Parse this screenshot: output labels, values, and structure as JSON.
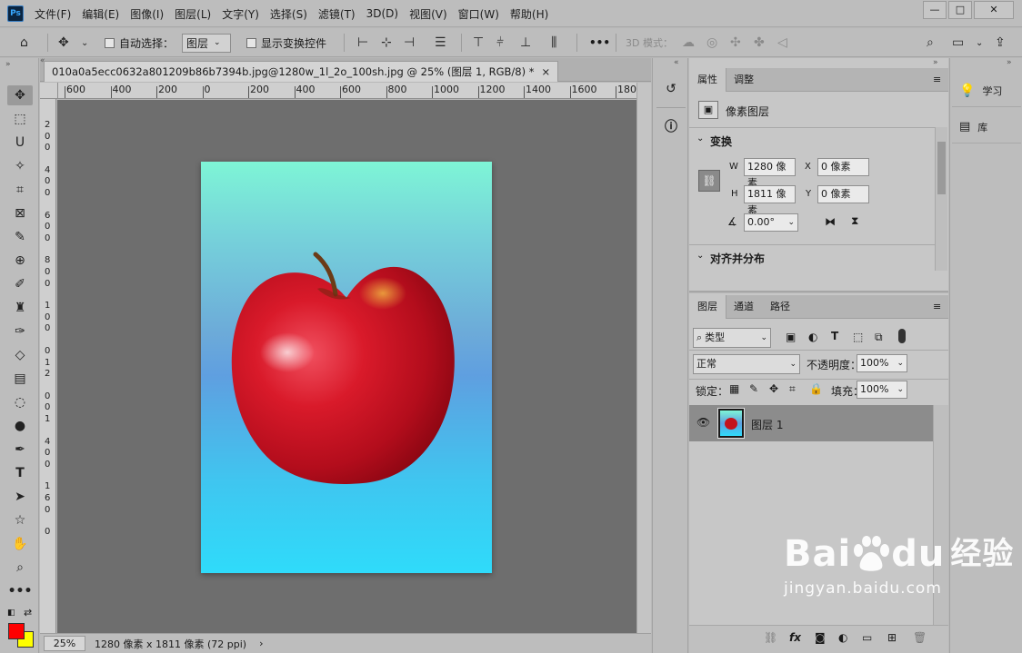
{
  "app": {
    "logo": "Ps"
  },
  "menu": [
    "文件(F)",
    "编辑(E)",
    "图像(I)",
    "图层(L)",
    "文字(Y)",
    "选择(S)",
    "滤镜(T)",
    "3D(D)",
    "视图(V)",
    "窗口(W)",
    "帮助(H)"
  ],
  "window_controls": {
    "minimize": "—",
    "maximize": "□",
    "close": "✕"
  },
  "options": {
    "auto_select_label": "自动选择：",
    "auto_select_target": "图层",
    "show_transform_label": "显示变换控件",
    "more": "•••",
    "mode_3d_label": "3D 模式："
  },
  "document": {
    "tab_title": "010a0a5ecc0632a801209b86b7394b.jpg@1280w_1l_2o_100sh.jpg @ 25% (图层 1, RGB/8) *",
    "close": "×",
    "ruler_h": [
      "600",
      "400",
      "200",
      "0",
      "200",
      "400",
      "600",
      "800",
      "1000",
      "1200",
      "1400",
      "1600",
      "1800"
    ],
    "ruler_v": [
      "2",
      "0",
      "0",
      "4",
      "0",
      "0",
      "6",
      "0",
      "0",
      "8",
      "0",
      "0",
      "1",
      "0",
      "0",
      "0",
      "1",
      "2",
      "0",
      "0",
      "1",
      "4",
      "0",
      "0",
      "1",
      "6",
      "0",
      "0"
    ]
  },
  "status": {
    "zoom": "25%",
    "info": "1280 像素 x 1811 像素 (72 ppi)",
    "arrow": "›"
  },
  "properties": {
    "tabs": [
      "属性",
      "调整"
    ],
    "kind": "像素图层",
    "transform_title": "变换",
    "w_label": "W",
    "w_value": "1280 像素",
    "x_label": "X",
    "x_value": "0 像素",
    "h_label": "H",
    "h_value": "1811 像素",
    "y_label": "Y",
    "y_value": "0 像素",
    "angle": "0.00°",
    "align_title": "对齐并分布"
  },
  "layers": {
    "tabs": [
      "图层",
      "通道",
      "路径"
    ],
    "filter_kind": "类型",
    "blend_mode": "正常",
    "opacity_label": "不透明度：",
    "opacity_value": "100%",
    "lock_label": "锁定：",
    "fill_label": "填充：",
    "fill_value": "100%",
    "layer_name": "图层 1",
    "footer_fx": "fx"
  },
  "right_panels": {
    "learn": "学习",
    "library": "库"
  },
  "watermark": {
    "brand": "Bai",
    "brand2": "du",
    "brand_cn": "经验",
    "url": "jingyan.baidu.com"
  },
  "colors": {
    "foreground": "#ff0000",
    "background": "#ffff00",
    "accent": "#38a8ff"
  }
}
